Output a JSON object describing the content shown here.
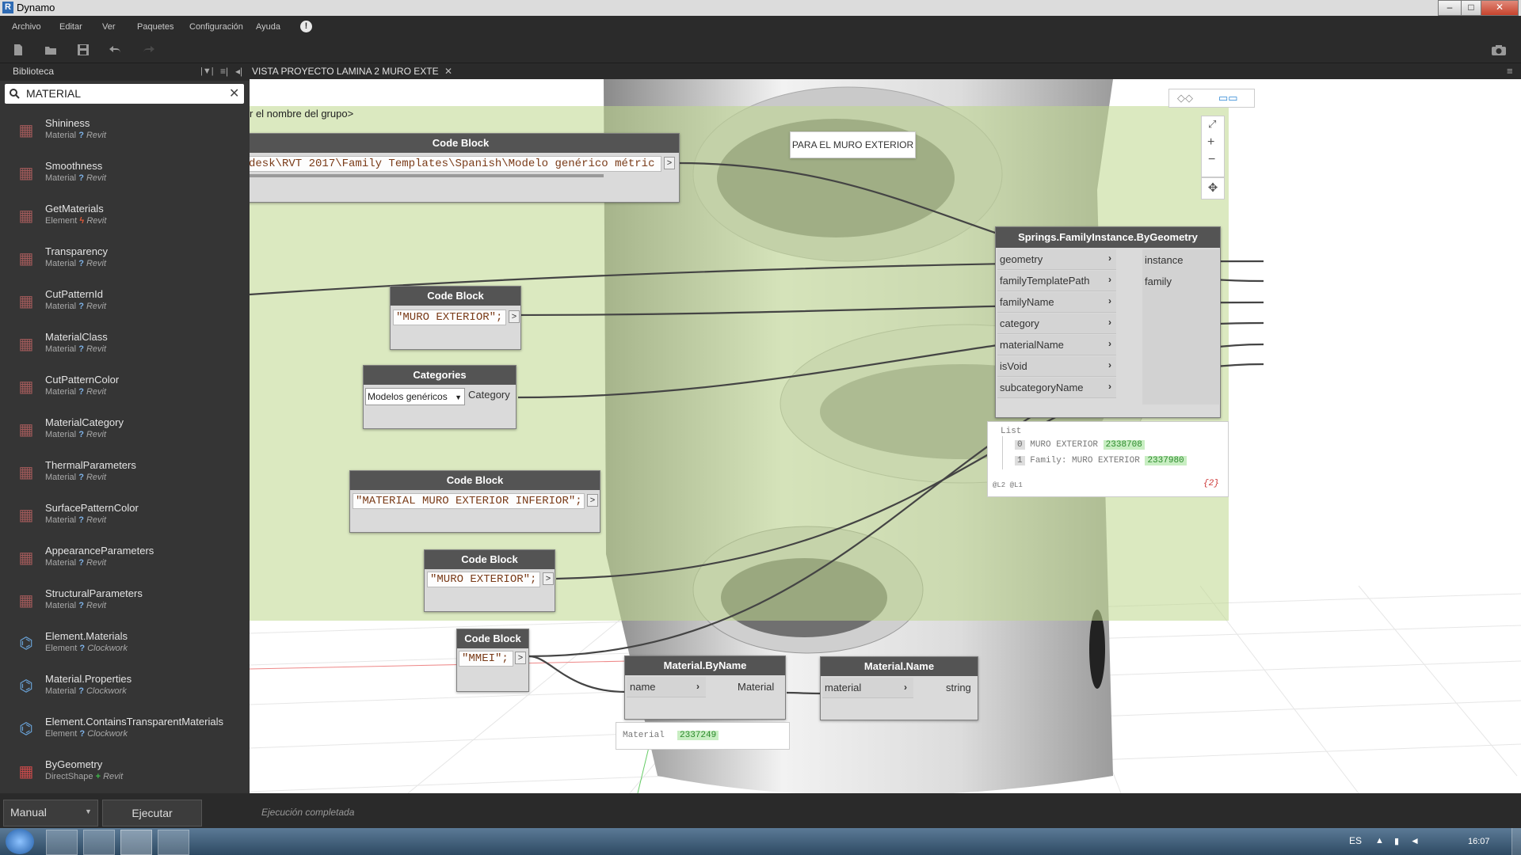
{
  "window": {
    "title": "Dynamo",
    "controls": [
      "minimize-icon",
      "maximize-icon",
      "close-icon"
    ]
  },
  "menu": [
    "Archivo",
    "Editar",
    "Ver",
    "Paquetes",
    "Configuración",
    "Ayuda"
  ],
  "library": {
    "header": "Biblioteca",
    "search_value": "MATERIAL",
    "items": [
      {
        "name": "Shininess",
        "category": "Material",
        "source": "Revit",
        "kind": "query"
      },
      {
        "name": "Smoothness",
        "category": "Material",
        "source": "Revit",
        "kind": "query"
      },
      {
        "name": "GetMaterials",
        "category": "Element",
        "source": "Revit",
        "kind": "action"
      },
      {
        "name": "Transparency",
        "category": "Material",
        "source": "Revit",
        "kind": "query"
      },
      {
        "name": "CutPatternId",
        "category": "Material",
        "source": "Revit",
        "kind": "query"
      },
      {
        "name": "MaterialClass",
        "category": "Material",
        "source": "Revit",
        "kind": "query"
      },
      {
        "name": "CutPatternColor",
        "category": "Material",
        "source": "Revit",
        "kind": "query"
      },
      {
        "name": "MaterialCategory",
        "category": "Material",
        "source": "Revit",
        "kind": "query"
      },
      {
        "name": "ThermalParameters",
        "category": "Material",
        "source": "Revit",
        "kind": "query"
      },
      {
        "name": "SurfacePatternColor",
        "category": "Material",
        "source": "Revit",
        "kind": "query"
      },
      {
        "name": "AppearanceParameters",
        "category": "Material",
        "source": "Revit",
        "kind": "query"
      },
      {
        "name": "StructuralParameters",
        "category": "Material",
        "source": "Revit",
        "kind": "query"
      },
      {
        "name": "Element.Materials",
        "category": "Element",
        "source": "Clockwork",
        "kind": "query"
      },
      {
        "name": "Material.Properties",
        "category": "Material",
        "source": "Clockwork",
        "kind": "query"
      },
      {
        "name": "Element.ContainsTransparentMaterials",
        "category": "Element",
        "source": "Clockwork",
        "kind": "query"
      },
      {
        "name": "ByGeometry",
        "category": "DirectShape",
        "source": "Revit",
        "kind": "create"
      }
    ]
  },
  "tab": {
    "label": "VISTA PROYECTO LAMINA 2 MURO EXTE"
  },
  "canvas": {
    "group_title": "r el nombre del grupo>",
    "note": "PARA EL MURO EXTERIOR",
    "nodes": {
      "cb_path": {
        "title": "Code Block",
        "code": "desk\\RVT 2017\\Family Templates\\Spanish\\Modelo genérico métric"
      },
      "cb_muro1": {
        "title": "Code Block",
        "code": "\"MURO EXTERIOR\";"
      },
      "categories": {
        "title": "Categories",
        "selected": "Modelos genéricos",
        "output": "Category"
      },
      "cb_material": {
        "title": "Code Block",
        "code": "\"MATERIAL MURO EXTERIOR INFERIOR\";"
      },
      "cb_muro2": {
        "title": "Code Block",
        "code": "\"MURO EXTERIOR\";"
      },
      "cb_mmei": {
        "title": "Code Block",
        "code": "\"MMEI\";"
      },
      "springs": {
        "title": "Springs.FamilyInstance.ByGeometry",
        "inputs": [
          "geometry",
          "familyTemplatePath",
          "familyName",
          "category",
          "materialName",
          "isVoid",
          "subcategoryName"
        ],
        "outputs": [
          "instance",
          "family"
        ]
      },
      "mat_byname": {
        "title": "Material.ByName",
        "input": "name",
        "output": "Material"
      },
      "mat_name": {
        "title": "Material.Name",
        "input": "material",
        "output": "string"
      }
    },
    "springs_preview": {
      "header": "List",
      "rows": [
        {
          "index": "0",
          "text": "MURO EXTERIOR",
          "id": "2338708"
        },
        {
          "index": "1",
          "text": "Family: MURO EXTERIOR",
          "id": "2337980"
        }
      ],
      "levels": "@L2 @L1",
      "count": "{2}"
    },
    "material_preview": {
      "label": "Material",
      "id": "2337249"
    }
  },
  "bottom": {
    "run_mode": "Manual",
    "run_label": "Ejecutar",
    "status": "Ejecución completada"
  },
  "taskbar": {
    "lang": "ES",
    "time": "16:07"
  },
  "colors": {
    "group_bg": "#cfe0a6",
    "node_header": "#545454",
    "library_bg": "#353535",
    "id_tag": "#c8eec2"
  }
}
